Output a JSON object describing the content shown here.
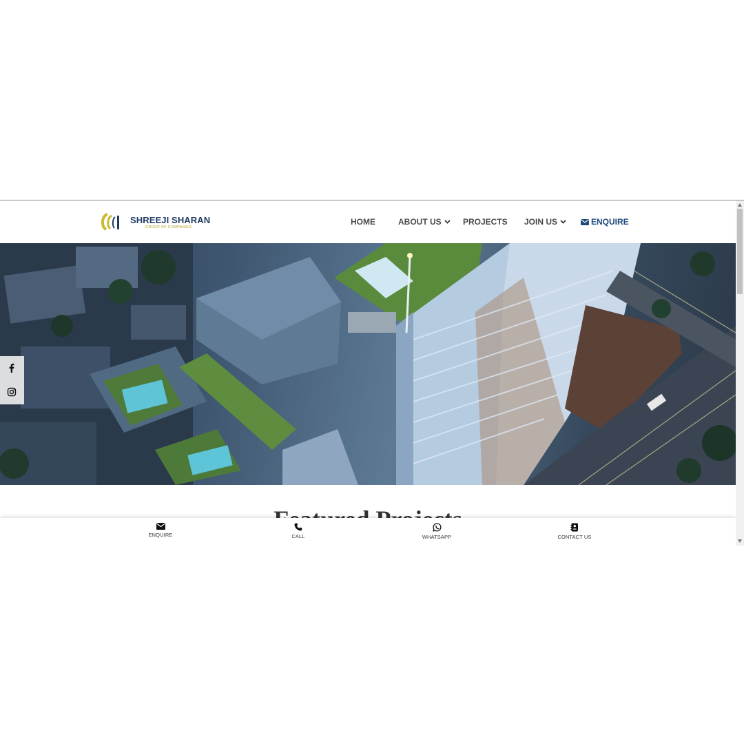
{
  "brand": {
    "name": "SHREEJI SHARAN",
    "tagline": "GROUP OF COMPANIES"
  },
  "nav": {
    "home": "HOME",
    "about": "ABOUT US",
    "projects": "PROJECTS",
    "join": "JOIN US",
    "enquire": "ENQUIRE"
  },
  "hero": {
    "image": "aerial-night-render-of-residential-tower"
  },
  "social": {
    "icons": [
      "facebook-icon",
      "instagram-icon"
    ]
  },
  "section": {
    "heading": "Featured Projects"
  },
  "bottom_bar": {
    "enquire": "ENQUIRE",
    "call": "CALL",
    "whatsapp": "WHATSAPP",
    "contact": "CONTACT US"
  },
  "colors": {
    "brand_navy": "#1f3b64",
    "brand_gold": "#c9b92e",
    "nav_text": "#4a4a4a",
    "enquire_accent": "#1f4a7c"
  }
}
